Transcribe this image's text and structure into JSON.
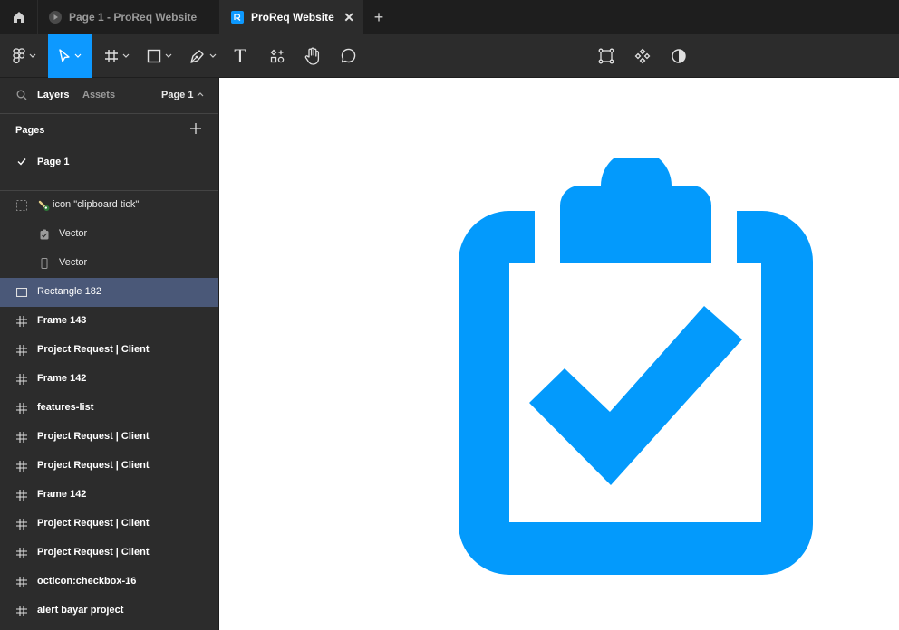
{
  "tabs": [
    {
      "label": "Page 1 - ProReq Website"
    },
    {
      "label": "ProReq Website",
      "close": "✕"
    }
  ],
  "add_tab": "+",
  "toolbar": {
    "icons": [
      "figma-menu-icon",
      "move-icon",
      "frame-icon",
      "rectangle-icon",
      "pen-icon",
      "text-icon",
      "resources-icon",
      "hand-icon",
      "comment-icon",
      "edit-object-icon",
      "component-icon",
      "contrast-icon"
    ],
    "text_tool": "T"
  },
  "sidebar": {
    "tab_layers": "Layers",
    "tab_assets": "Assets",
    "page_selector": "Page 1",
    "pages_heading": "Pages",
    "pages": [
      {
        "label": "Page 1"
      }
    ],
    "layers": [
      {
        "label": "icon \"clipboard tick\"",
        "kind": "top"
      },
      {
        "label": "Vector",
        "kind": "child"
      },
      {
        "label": "Vector",
        "kind": "child"
      },
      {
        "label": "Rectangle 182",
        "kind": "selected"
      },
      {
        "label": "Frame 143",
        "kind": "frame"
      },
      {
        "label": "Project Request | Client",
        "kind": "frame"
      },
      {
        "label": "Frame 142",
        "kind": "frame"
      },
      {
        "label": "features-list",
        "kind": "frame"
      },
      {
        "label": "Project Request | Client",
        "kind": "frame"
      },
      {
        "label": "Project Request | Client",
        "kind": "frame"
      },
      {
        "label": "Frame 142",
        "kind": "frame"
      },
      {
        "label": "Project Request | Client",
        "kind": "frame"
      },
      {
        "label": "Project Request | Client",
        "kind": "frame"
      },
      {
        "label": "octicon:checkbox-16",
        "kind": "frame"
      },
      {
        "label": "alert bayar project",
        "kind": "frame"
      }
    ]
  },
  "colors": {
    "accent": "#0d99ff",
    "clipboard": "#039afc",
    "selected_row": "#4a5878",
    "panel": "#2c2c2c",
    "tabbar": "#1e1e1e"
  }
}
